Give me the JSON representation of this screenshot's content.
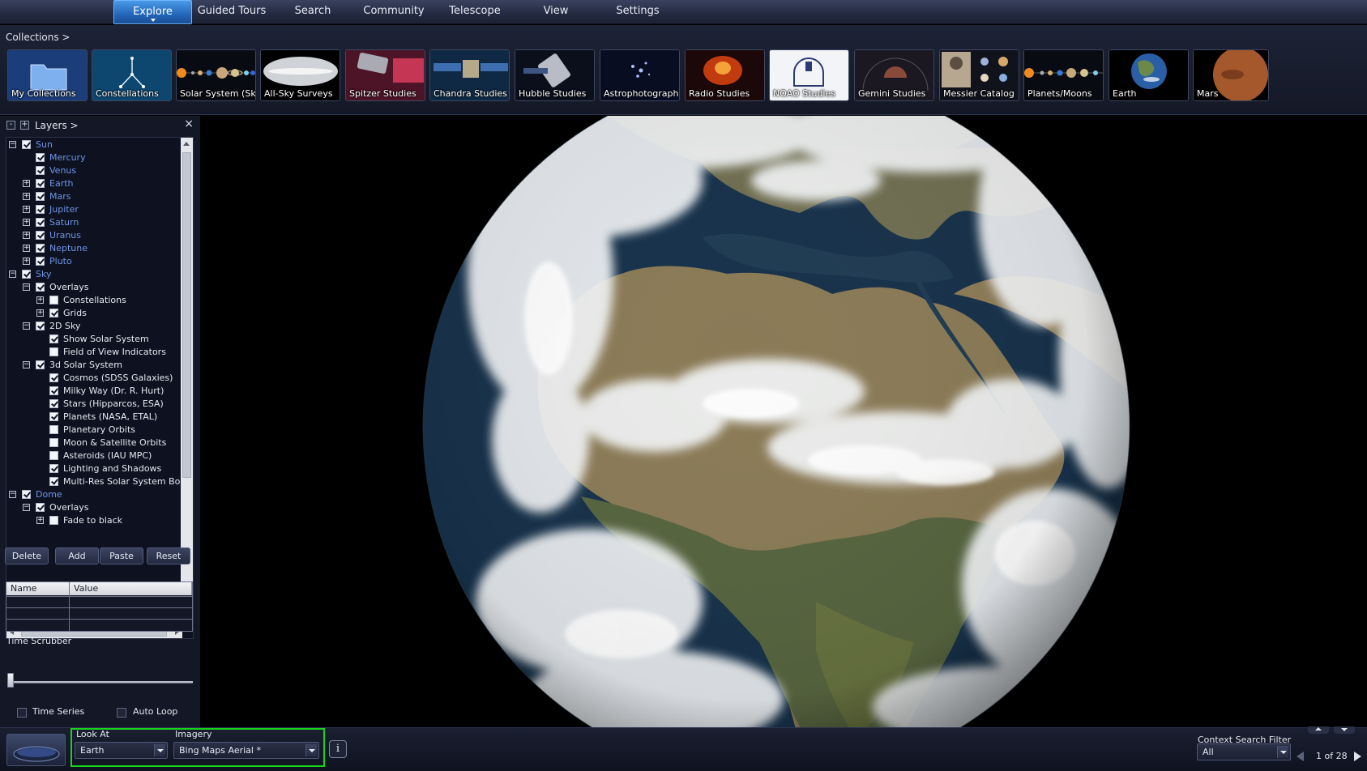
{
  "menu": {
    "items": [
      {
        "label": "Explore",
        "active": true
      },
      {
        "label": "Guided Tours"
      },
      {
        "label": "Search"
      },
      {
        "label": "Community"
      },
      {
        "label": "Telescope"
      },
      {
        "label": "View"
      },
      {
        "label": "Settings"
      }
    ]
  },
  "collections": {
    "breadcrumb": "Collections  >",
    "items": [
      {
        "label": "My Collections",
        "icon": "folder-icon"
      },
      {
        "label": "Constellations",
        "icon": "constellation-icon"
      },
      {
        "label": "Solar System (Sky)",
        "icon": "planets-icon"
      },
      {
        "label": "All-Sky Surveys",
        "icon": "allsky-icon"
      },
      {
        "label": "Spitzer Studies",
        "icon": "telescope-icon"
      },
      {
        "label": "Chandra Studies",
        "icon": "satellite-icon"
      },
      {
        "label": "Hubble Studies",
        "icon": "hubble-icon"
      },
      {
        "label": "Astrophotography",
        "icon": "stars-icon"
      },
      {
        "label": "Radio Studies",
        "icon": "radio-icon"
      },
      {
        "label": "NOAO Studies",
        "icon": "observatory-icon"
      },
      {
        "label": "Gemini Studies",
        "icon": "dome-icon"
      },
      {
        "label": "Messier Catalog",
        "icon": "messier-icon"
      },
      {
        "label": "Planets/Moons",
        "icon": "planets-moons-icon"
      },
      {
        "label": "Earth",
        "icon": "earth-icon"
      },
      {
        "label": "Mars",
        "icon": "mars-icon"
      }
    ]
  },
  "layers": {
    "title": "Layers  >",
    "collapse_label": "-",
    "expand_label": "+",
    "close_label": "×",
    "rows": [
      {
        "label": "Sun",
        "depth": 0,
        "expander": "−",
        "checked": true,
        "link": true
      },
      {
        "label": "Mercury",
        "depth": 1,
        "expander": "",
        "checked": true,
        "link": true
      },
      {
        "label": "Venus",
        "depth": 1,
        "expander": "",
        "checked": true,
        "link": true
      },
      {
        "label": "Earth",
        "depth": 1,
        "expander": "+",
        "checked": true,
        "link": true
      },
      {
        "label": "Mars",
        "depth": 1,
        "expander": "+",
        "checked": true,
        "link": true
      },
      {
        "label": "Jupiter",
        "depth": 1,
        "expander": "+",
        "checked": true,
        "link": true
      },
      {
        "label": "Saturn",
        "depth": 1,
        "expander": "+",
        "checked": true,
        "link": true
      },
      {
        "label": "Uranus",
        "depth": 1,
        "expander": "+",
        "checked": true,
        "link": true
      },
      {
        "label": "Neptune",
        "depth": 1,
        "expander": "+",
        "checked": true,
        "link": true
      },
      {
        "label": "Pluto",
        "depth": 1,
        "expander": "+",
        "checked": true,
        "link": true
      },
      {
        "label": "Sky",
        "depth": 0,
        "expander": "−",
        "checked": true,
        "link": true
      },
      {
        "label": "Overlays",
        "depth": 1,
        "expander": "−",
        "checked": true,
        "link": false
      },
      {
        "label": "Constellations",
        "depth": 2,
        "expander": "+",
        "checked": false,
        "link": false
      },
      {
        "label": "Grids",
        "depth": 2,
        "expander": "+",
        "checked": true,
        "link": false
      },
      {
        "label": "2D Sky",
        "depth": 1,
        "expander": "−",
        "checked": true,
        "link": false
      },
      {
        "label": "Show Solar System",
        "depth": 2,
        "expander": "",
        "checked": true,
        "link": false
      },
      {
        "label": "Field of View Indicators",
        "depth": 2,
        "expander": "",
        "checked": false,
        "link": false
      },
      {
        "label": "3d Solar System",
        "depth": 1,
        "expander": "−",
        "checked": true,
        "link": false
      },
      {
        "label": "Cosmos (SDSS Galaxies)",
        "depth": 2,
        "expander": "",
        "checked": true,
        "link": false
      },
      {
        "label": "Milky Way (Dr. R. Hurt)",
        "depth": 2,
        "expander": "",
        "checked": true,
        "link": false
      },
      {
        "label": "Stars (Hipparcos, ESA)",
        "depth": 2,
        "expander": "",
        "checked": true,
        "link": false
      },
      {
        "label": "Planets (NASA, ETAL)",
        "depth": 2,
        "expander": "",
        "checked": true,
        "link": false
      },
      {
        "label": "Planetary Orbits",
        "depth": 2,
        "expander": "",
        "checked": false,
        "link": false
      },
      {
        "label": "Moon & Satellite Orbits",
        "depth": 2,
        "expander": "",
        "checked": false,
        "link": false
      },
      {
        "label": "Asteroids (IAU MPC)",
        "depth": 2,
        "expander": "",
        "checked": false,
        "link": false
      },
      {
        "label": "Lighting and Shadows",
        "depth": 2,
        "expander": "",
        "checked": true,
        "link": false
      },
      {
        "label": "Multi-Res Solar System Bodies",
        "depth": 2,
        "expander": "",
        "checked": true,
        "link": false
      },
      {
        "label": "Dome",
        "depth": 0,
        "expander": "−",
        "checked": true,
        "link": true
      },
      {
        "label": "Overlays",
        "depth": 1,
        "expander": "−",
        "checked": true,
        "link": false
      },
      {
        "label": "Fade to black",
        "depth": 2,
        "expander": "+",
        "checked": false,
        "link": false
      }
    ]
  },
  "actions": {
    "delete": "Delete",
    "add": "Add",
    "paste": "Paste",
    "reset": "Reset"
  },
  "properties": {
    "name_header": "Name",
    "value_header": "Value"
  },
  "time": {
    "scrubber_label": "Time Scrubber",
    "time_series": "Time Series",
    "auto_loop": "Auto Loop",
    "scrubber_position": 0
  },
  "bottom": {
    "look_at_label": "Look At",
    "look_at_value": "Earth",
    "imagery_label": "Imagery",
    "imagery_value": "Bing Maps Aerial *",
    "info_label": "i",
    "context_label": "Context Search Filter",
    "context_value": "All",
    "pager": "1 of 28"
  },
  "colors": {
    "accent": "#2a6fc6",
    "highlight": "#19d31d",
    "link": "#6f93e6"
  }
}
